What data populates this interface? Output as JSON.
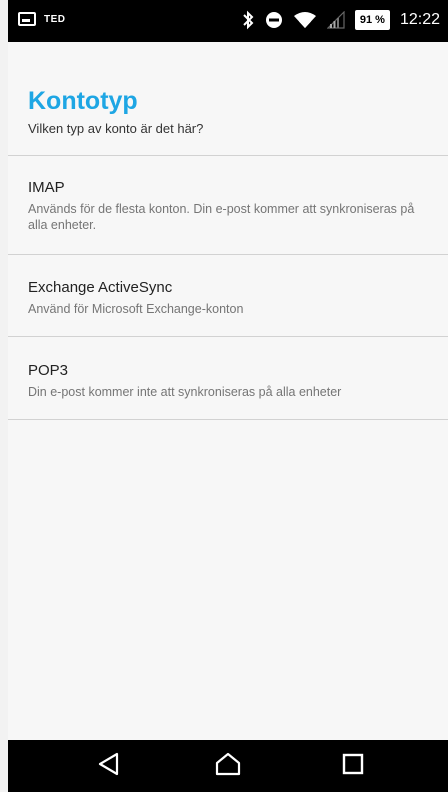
{
  "status_bar": {
    "carrier": "TED",
    "battery": "91 %",
    "time": "12:22"
  },
  "header": {
    "title": "Kontotyp",
    "subtitle": "Vilken typ av konto är det här?"
  },
  "options": [
    {
      "title": "IMAP",
      "description": "Används för de flesta konton. Din e-post kommer att synkroniseras på alla enheter."
    },
    {
      "title": "Exchange ActiveSync",
      "description": "Använd för Microsoft Exchange-konton"
    },
    {
      "title": "POP3",
      "description": "Din e-post kommer inte att synkroniseras på alla enheter"
    }
  ],
  "colors": {
    "accent": "#1ea6e4",
    "status_bar": "#000000",
    "background": "#f7f7f7"
  },
  "icons": {
    "status": [
      "screen-icon",
      "bluetooth-icon",
      "do-not-disturb-icon",
      "wifi-icon",
      "signal-icon",
      "battery-icon"
    ],
    "nav": [
      "back-icon",
      "home-icon",
      "recents-icon"
    ]
  }
}
